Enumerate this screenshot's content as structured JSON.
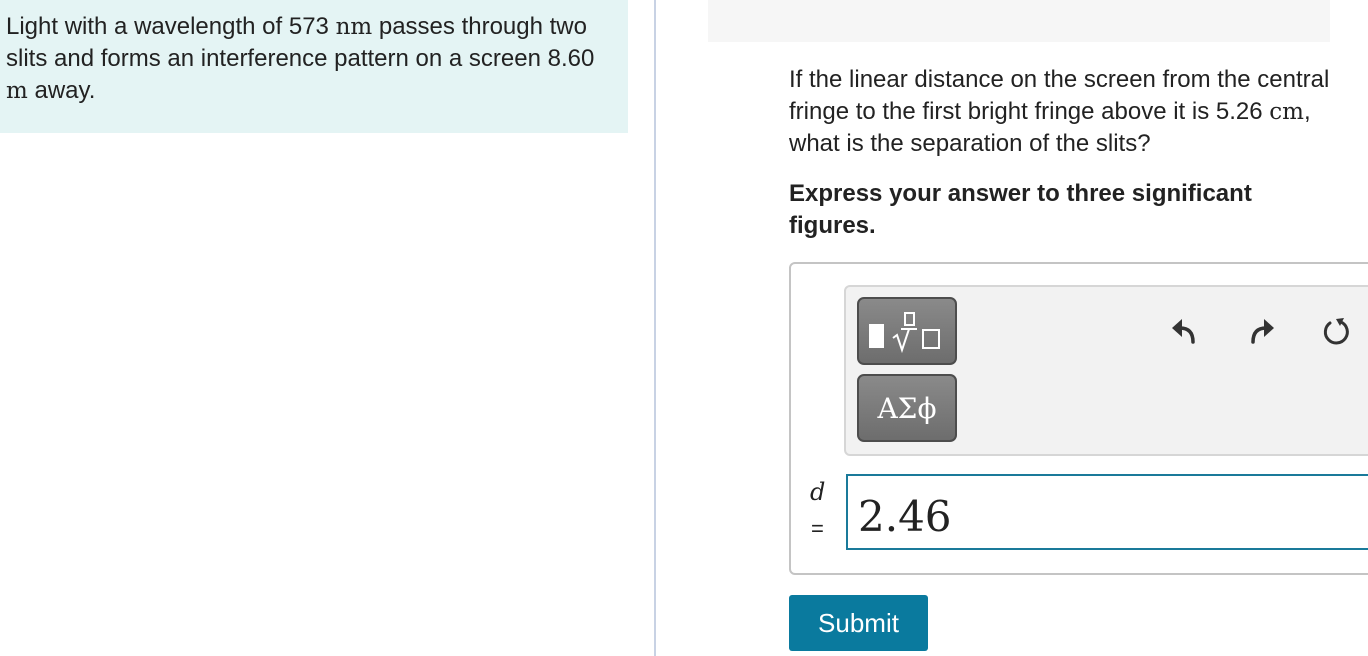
{
  "intro": {
    "part1": "Light with a wavelength of 573 ",
    "unit1": "nm",
    "part2": " passes through two slits and forms an interference pattern on a screen 8.60 ",
    "unit2": "m",
    "part3": " away."
  },
  "question": {
    "part1": "If the linear distance on the screen from the central fringe to the first bright fringe above it is 5.26 ",
    "unit": "cm",
    "part2": ", what is the separation of the slits?"
  },
  "instruction": "Express your answer to three significant figures.",
  "toolbar": {
    "templates_icon": "fraction-sqrt-templates-icon",
    "greek_label": "ΑΣϕ",
    "undo_icon": "undo-arrow-icon",
    "redo_icon": "redo-arrow-icon",
    "reset_icon": "reset-circular-arrow-icon"
  },
  "answer": {
    "variable": "d",
    "equals": "=",
    "value": "2.46"
  },
  "submit_label": "Submit",
  "colors": {
    "intro_bg": "#e4f4f4",
    "input_border": "#1a7a9a",
    "submit_bg": "#0a7a9e",
    "tool_button": "#7a7a7a"
  }
}
